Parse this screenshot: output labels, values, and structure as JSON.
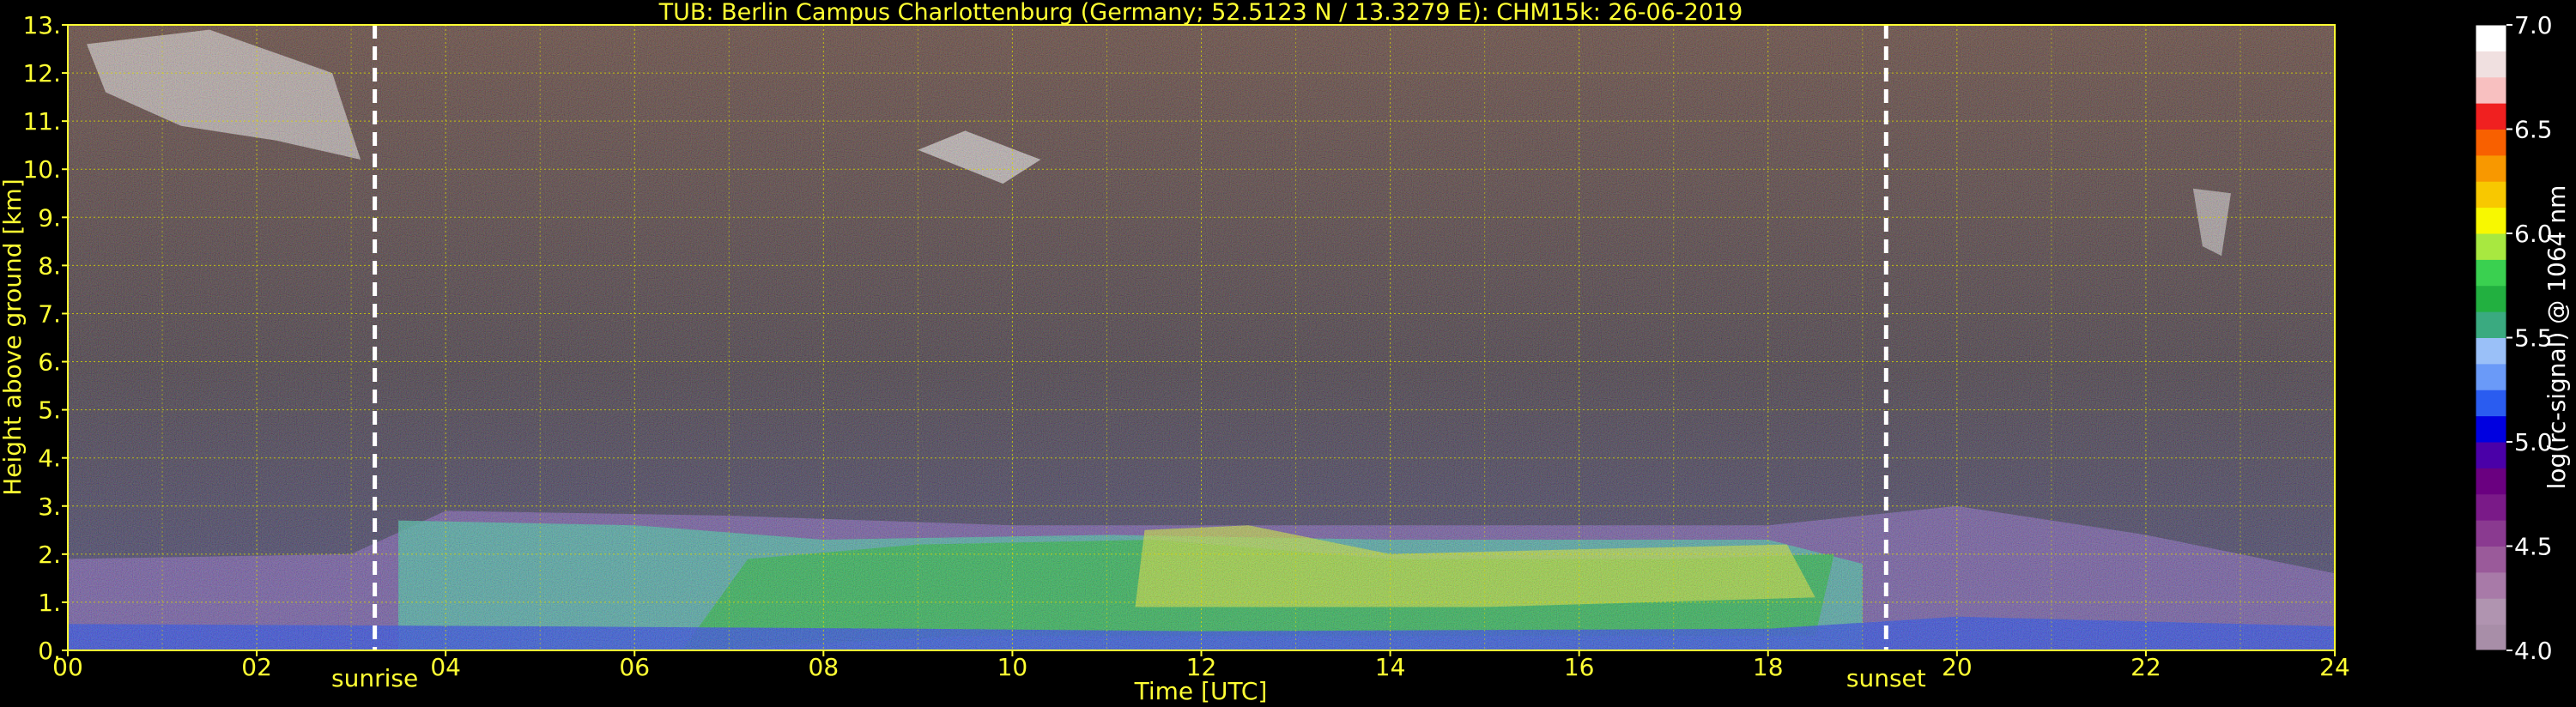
{
  "chart_data": {
    "type": "heatmap",
    "title": "TUB: Berlin Campus Charlottenburg (Germany; 52.5123 N / 13.3279 E):    CHM15k: 26-06-2019",
    "xlabel": "Time [UTC]",
    "ylabel": "Height above ground [km]",
    "xlim": [
      0,
      24
    ],
    "ylim": [
      0,
      13
    ],
    "x_ticks": [
      0,
      2,
      4,
      6,
      8,
      10,
      12,
      14,
      16,
      18,
      20,
      22,
      24
    ],
    "x_tick_labels": [
      "00",
      "02",
      "04",
      "06",
      "08",
      "10",
      "12",
      "14",
      "16",
      "18",
      "20",
      "22",
      "24"
    ],
    "y_ticks": [
      0,
      1,
      2,
      3,
      4,
      5,
      6,
      7,
      8,
      9,
      10,
      11,
      12,
      13
    ],
    "y_tick_labels": [
      "0.",
      "1.",
      "2.",
      "3.",
      "4.",
      "5.",
      "6.",
      "7.",
      "8.",
      "9.",
      "10.",
      "11.",
      "12.",
      "13."
    ],
    "grid": true,
    "markers": [
      {
        "label": "sunrise",
        "x": 3.25
      },
      {
        "label": "sunset",
        "x": 19.25
      }
    ],
    "colorbar": {
      "label": "log(rc-signal) @ 1064 nm",
      "range": [
        4.0,
        7.0
      ],
      "ticks": [
        4.0,
        4.5,
        5.0,
        5.5,
        6.0,
        6.5,
        7.0
      ],
      "tick_labels": [
        "4.0",
        "4.5",
        "5.0",
        "5.5",
        "6.0",
        "6.5",
        "7.0"
      ],
      "levels": [
        {
          "v": 4.0,
          "color": "#a88ea8"
        },
        {
          "v": 4.125,
          "color": "#b094b0"
        },
        {
          "v": 4.25,
          "color": "#a87aa8"
        },
        {
          "v": 4.375,
          "color": "#9a5a9a"
        },
        {
          "v": 4.5,
          "color": "#8a3a90"
        },
        {
          "v": 4.625,
          "color": "#7a1a88"
        },
        {
          "v": 4.75,
          "color": "#6a0080"
        },
        {
          "v": 4.875,
          "color": "#4a00a8"
        },
        {
          "v": 5.0,
          "color": "#0000e0"
        },
        {
          "v": 5.125,
          "color": "#2a5cf0"
        },
        {
          "v": 5.25,
          "color": "#6a9af8"
        },
        {
          "v": 5.375,
          "color": "#9ac0f8"
        },
        {
          "v": 5.5,
          "color": "#3aaa80"
        },
        {
          "v": 5.625,
          "color": "#22b040"
        },
        {
          "v": 5.75,
          "color": "#3ad050"
        },
        {
          "v": 5.875,
          "color": "#a8e840"
        },
        {
          "v": 6.0,
          "color": "#f8f800"
        },
        {
          "v": 6.125,
          "color": "#f8c800"
        },
        {
          "v": 6.25,
          "color": "#f89800"
        },
        {
          "v": 6.375,
          "color": "#f86000"
        },
        {
          "v": 6.5,
          "color": "#f02020"
        },
        {
          "v": 6.625,
          "color": "#f8c0c0"
        },
        {
          "v": 6.75,
          "color": "#f0e0e0"
        },
        {
          "v": 6.875,
          "color": "#ffffff"
        }
      ]
    },
    "layers": [
      {
        "name": "noise",
        "color": "#5a3a30"
      },
      {
        "name": "upper-blue-noise",
        "color": "#3a3a70"
      },
      {
        "name": "residual-layer",
        "color": "#7a5ab0"
      },
      {
        "name": "boundary-layer-top",
        "color": "#40b8a0"
      },
      {
        "name": "boundary-layer-green",
        "color": "#20b040"
      },
      {
        "name": "convective-yellow",
        "color": "#c8e030"
      },
      {
        "name": "near-ground-blue",
        "color": "#2040e0"
      },
      {
        "name": "cloud",
        "color": "#ffffff"
      }
    ]
  }
}
